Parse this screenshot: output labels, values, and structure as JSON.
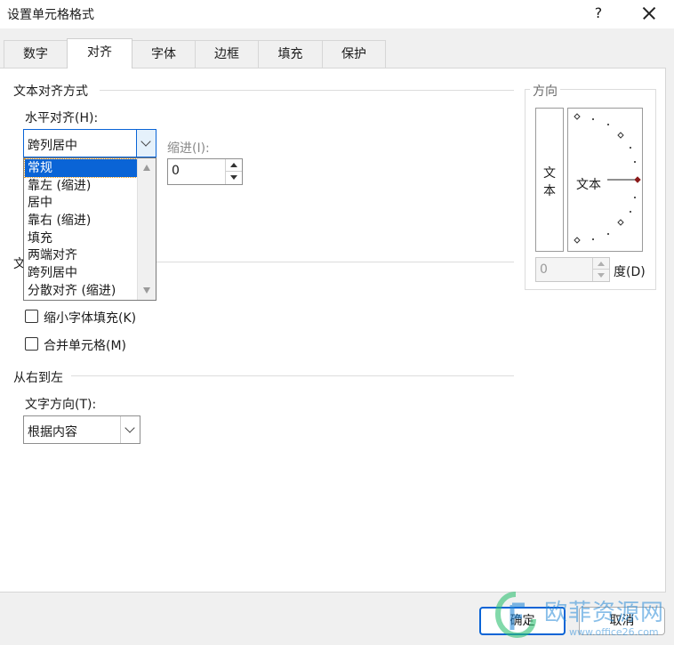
{
  "window": {
    "title": "设置单元格格式",
    "help": "?"
  },
  "tabs": [
    {
      "label": "数字"
    },
    {
      "label": "对齐"
    },
    {
      "label": "字体"
    },
    {
      "label": "边框"
    },
    {
      "label": "填充"
    },
    {
      "label": "保护"
    }
  ],
  "alignment": {
    "group_title": "文本对齐方式",
    "horizontal_label": "水平对齐(H):",
    "horizontal_value": "跨列居中",
    "indent_label": "缩进(I):",
    "indent_value": "0",
    "options": [
      "常规",
      "靠左 (缩进)",
      "居中",
      "靠右 (缩进)",
      "填充",
      "两端对齐",
      "跨列居中",
      "分散对齐 (缩进)"
    ],
    "selected_index": 0
  },
  "text_control": {
    "group_title_partial": "文",
    "shrink_to_fit": {
      "label": "缩小字体填充(K)",
      "checked": false
    },
    "merge_cells": {
      "label": "合并单元格(M)",
      "checked": false
    }
  },
  "rtl": {
    "group_title": "从右到左",
    "direction_label": "文字方向(T):",
    "direction_value": "根据内容"
  },
  "orientation": {
    "group_title": "方向",
    "vertical_text": [
      "文",
      "本"
    ],
    "horizontal_text": "文本",
    "degrees_value": "0",
    "degrees_label": "度(D)"
  },
  "buttons": {
    "ok": "确定",
    "cancel": "取消"
  },
  "watermark": {
    "text": "欧菲资源网",
    "url": "www.office26.com"
  },
  "colors": {
    "accent": "#0a64d6",
    "marker": "#8b1a1a",
    "watermark": "#2a8bd8"
  }
}
